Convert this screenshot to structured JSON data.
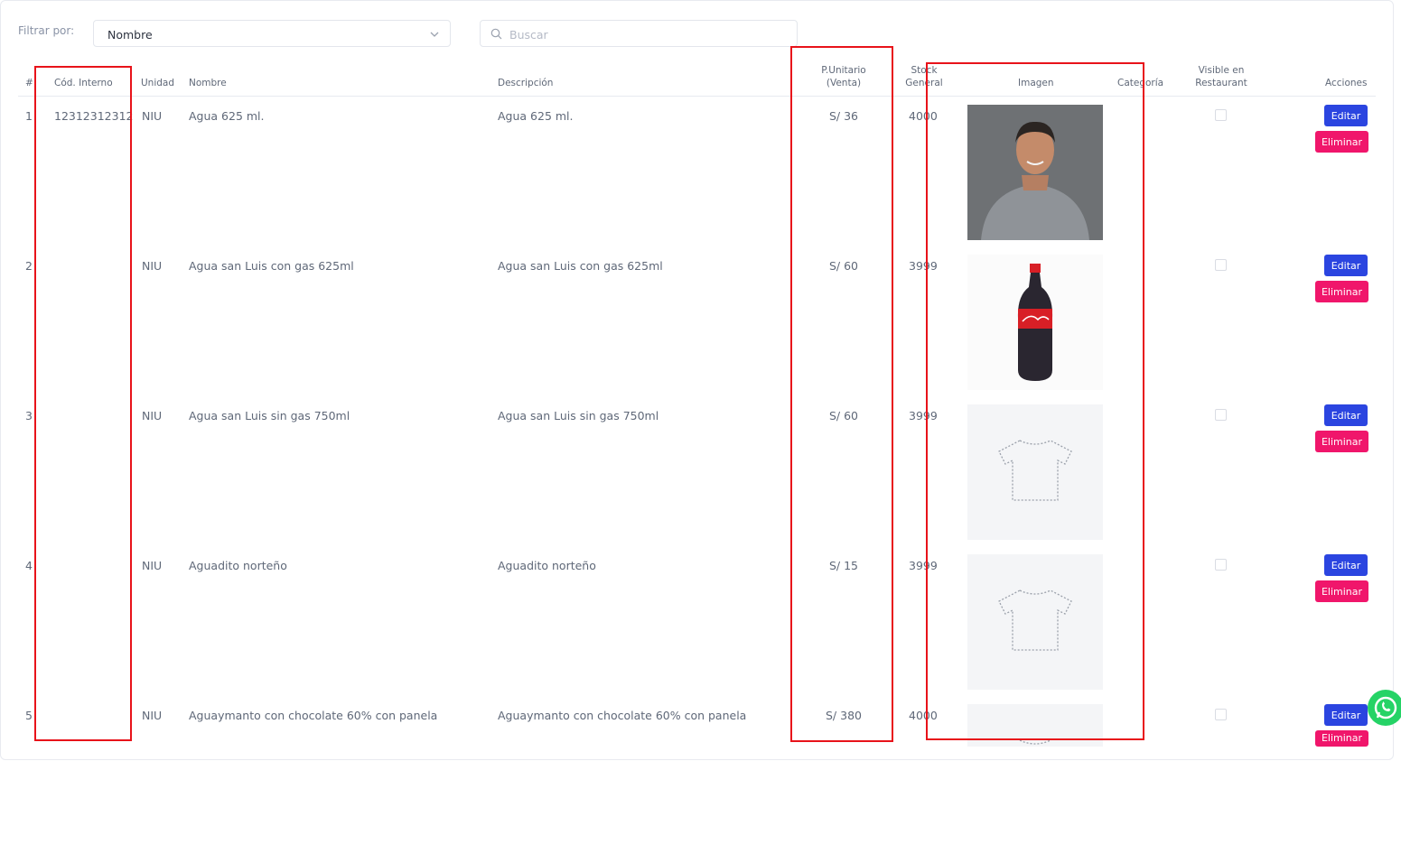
{
  "filter": {
    "label": "Filtrar por:",
    "selected": "Nombre",
    "search_placeholder": "Buscar"
  },
  "table": {
    "headers": {
      "num": "#",
      "codigo": "Cód. Interno",
      "unidad": "Unidad",
      "nombre": "Nombre",
      "descripcion": "Descripción",
      "precio_l1": "P.Unitario",
      "precio_l2": "(Venta)",
      "stock_l1": "Stock",
      "stock_l2": "General",
      "imagen": "Imagen",
      "categoria": "Categoría",
      "visible_l1": "Visible en",
      "visible_l2": "Restaurant",
      "acciones": "Acciones"
    },
    "rows": [
      {
        "num": "1",
        "codigo": "12312312312",
        "unidad": "NIU",
        "nombre": "Agua 625 ml.",
        "descripcion": "Agua 625 ml.",
        "precio": "S/ 36",
        "stock": "4000",
        "imagen": "person-photo",
        "visible": false
      },
      {
        "num": "2",
        "codigo": "",
        "unidad": "NIU",
        "nombre": "Agua san Luis con gas 625ml",
        "descripcion": "Agua san Luis con gas 625ml",
        "precio": "S/ 60",
        "stock": "3999",
        "imagen": "cola-bottle-photo",
        "visible": false
      },
      {
        "num": "3",
        "codigo": "",
        "unidad": "NIU",
        "nombre": "Agua san Luis sin gas 750ml",
        "descripcion": "Agua san Luis sin gas 750ml",
        "precio": "S/ 60",
        "stock": "3999",
        "imagen": "tshirt-placeholder",
        "visible": false
      },
      {
        "num": "4",
        "codigo": "",
        "unidad": "NIU",
        "nombre": "Aguadito norteño",
        "descripcion": "Aguadito norteño",
        "precio": "S/ 15",
        "stock": "3999",
        "imagen": "tshirt-placeholder",
        "visible": false
      },
      {
        "num": "5",
        "codigo": "",
        "unidad": "NIU",
        "nombre": "Aguaymanto con chocolate 60% con panela",
        "descripcion": "Aguaymanto con chocolate 60% con panela",
        "precio": "S/ 380",
        "stock": "4000",
        "imagen": "tshirt-placeholder",
        "visible": false
      }
    ],
    "edit_label": "Editar",
    "delete_label": "Eliminar"
  },
  "colors": {
    "edit_button": "#2b45e0",
    "delete_button": "#f0166b",
    "highlight_box": "#e8131a",
    "whatsapp": "#25d366"
  }
}
